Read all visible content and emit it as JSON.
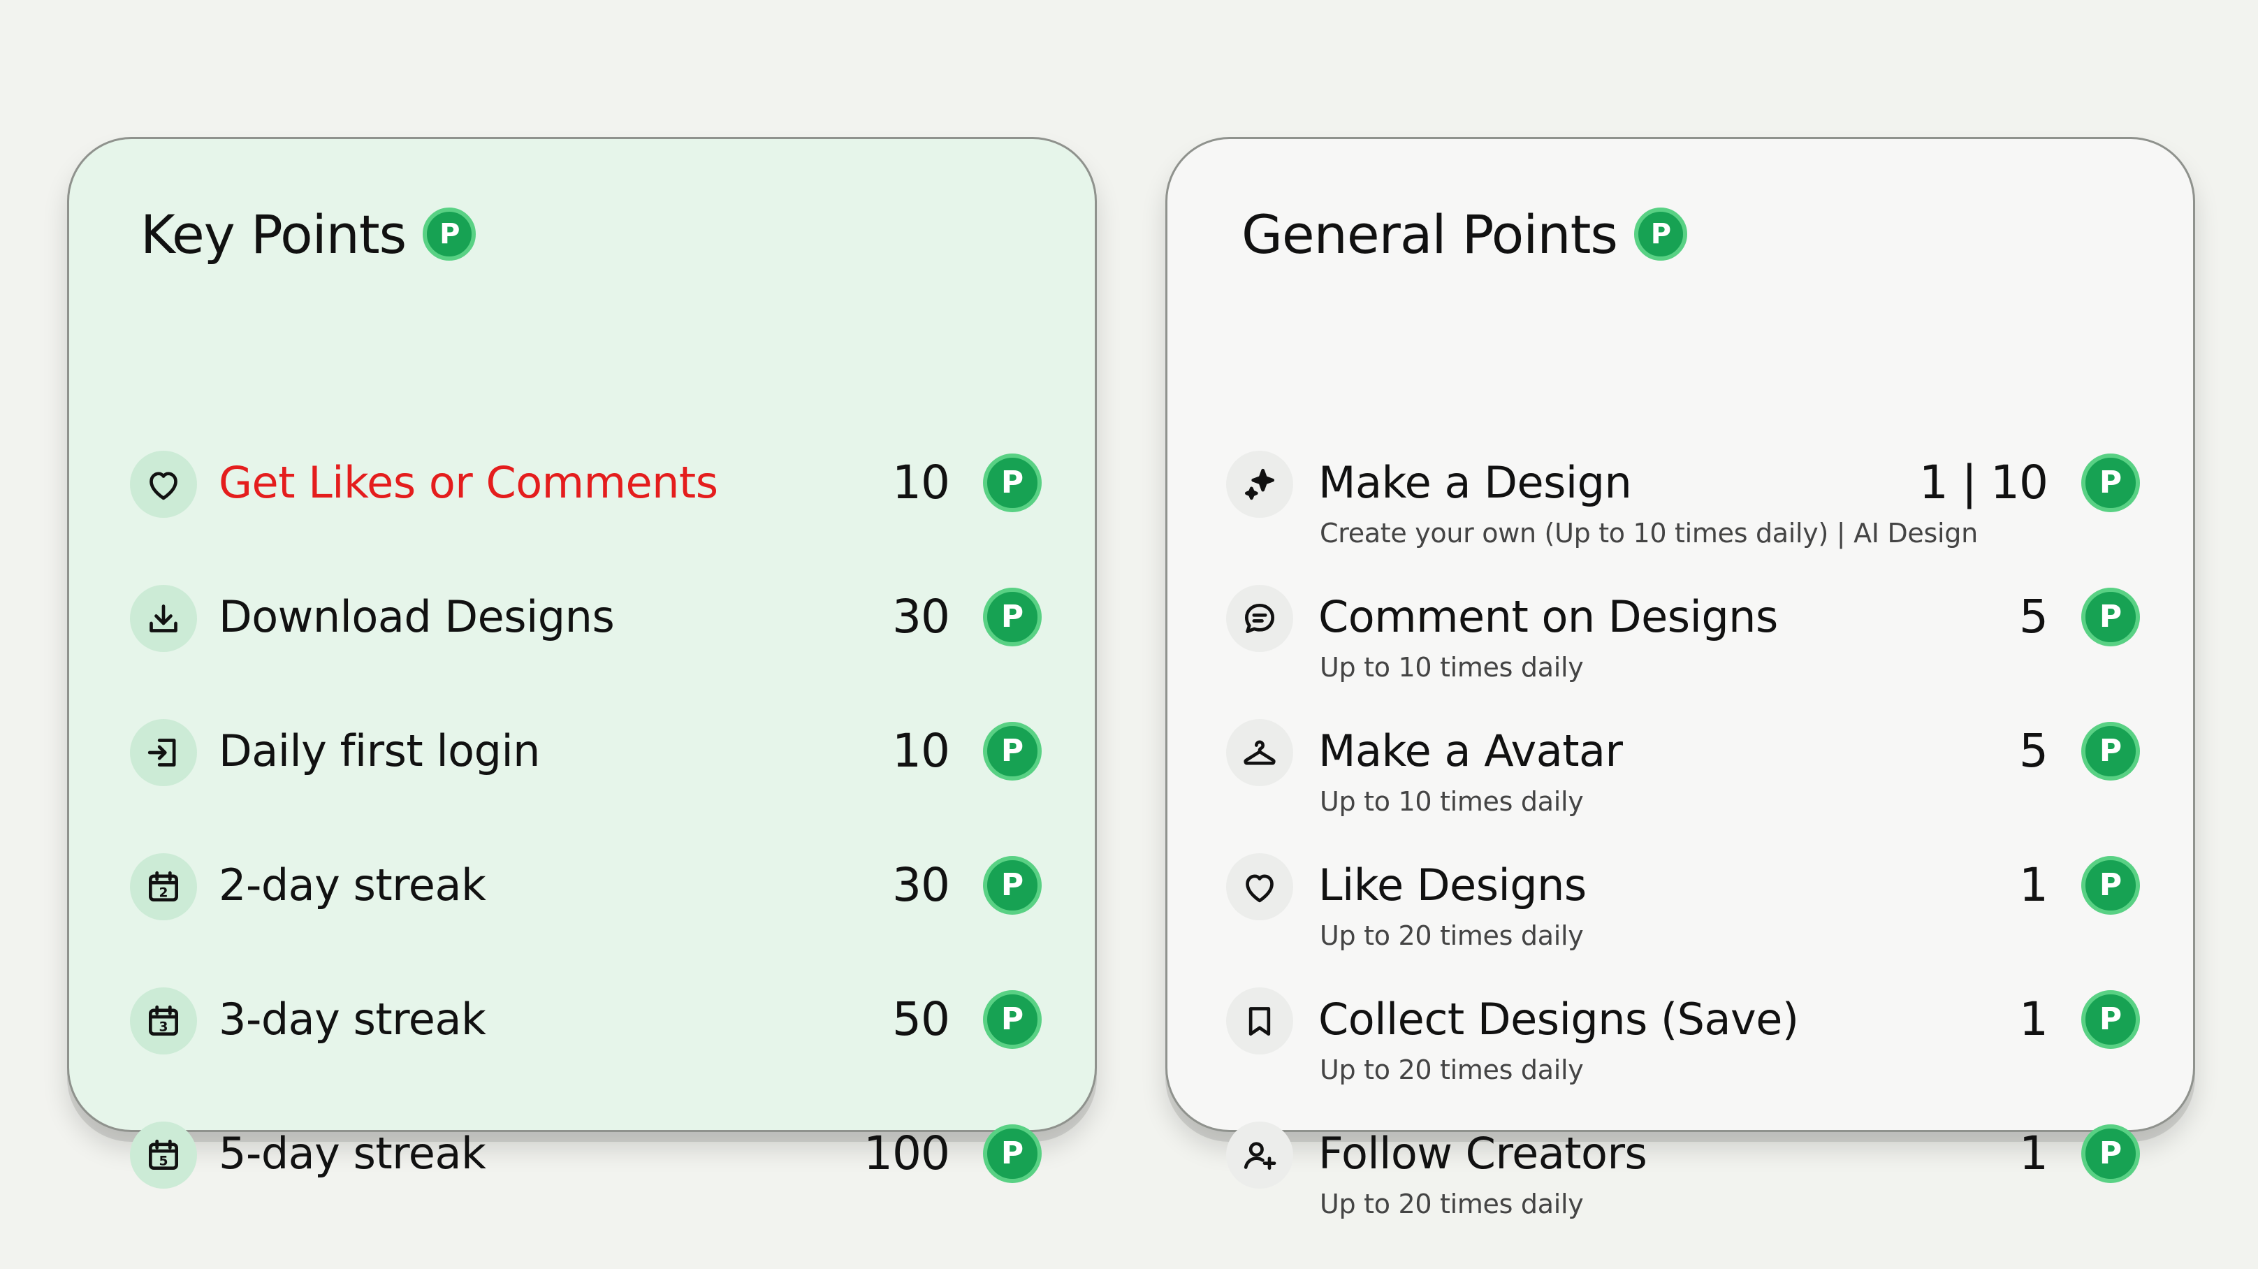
{
  "colors": {
    "accent_text": "#e41d1d",
    "coin": "#17a253",
    "coin_ring": "#59d184",
    "key_card_bg": "#e6f5ea",
    "general_card_bg": "#f7f7f6"
  },
  "coin_letter": "P",
  "key_points": {
    "title": "Key Points",
    "items": [
      {
        "icon": "heart-icon",
        "label": "Get Likes or Comments",
        "points": "10"
      },
      {
        "icon": "download-icon",
        "label": "Download Designs",
        "points": "30"
      },
      {
        "icon": "login-icon",
        "label": "Daily first login",
        "points": "10"
      },
      {
        "icon": "calendar-2-icon",
        "label": "2-day streak",
        "points": "30",
        "day": "2"
      },
      {
        "icon": "calendar-3-icon",
        "label": "3-day streak",
        "points": "50",
        "day": "3"
      },
      {
        "icon": "calendar-5-icon",
        "label": "5-day streak",
        "points": "100",
        "day": "5"
      }
    ]
  },
  "general_points": {
    "title": "General Points",
    "items": [
      {
        "icon": "sparkle-icon",
        "label": "Make a Design",
        "sub": "Create your own (Up to 10 times daily) | AI Design",
        "points": "1 | 10"
      },
      {
        "icon": "chat-icon",
        "label": "Comment on Designs",
        "sub": "Up to 10 times daily",
        "points": "5"
      },
      {
        "icon": "hanger-icon",
        "label": "Make a Avatar",
        "sub": "Up to 10 times daily",
        "points": "5"
      },
      {
        "icon": "heart-icon",
        "label": "Like Designs",
        "sub": "Up to 20 times daily",
        "points": "1"
      },
      {
        "icon": "bookmark-icon",
        "label": "Collect Designs (Save)",
        "sub": "Up to 20 times daily",
        "points": "1"
      },
      {
        "icon": "user-plus-icon",
        "label": "Follow Creators",
        "sub": "Up to 20 times daily",
        "points": "1"
      }
    ]
  }
}
